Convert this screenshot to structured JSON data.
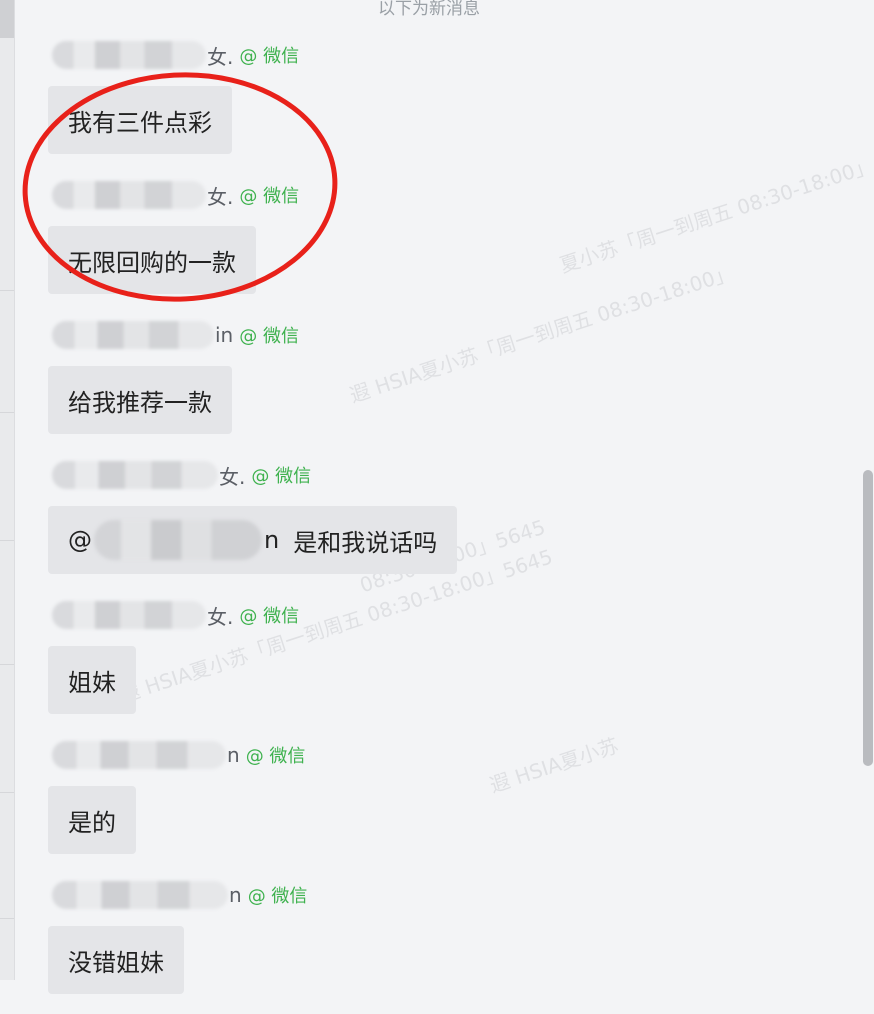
{
  "top_hint": "以下为新消息",
  "messages": [
    {
      "name_suffix": "女.",
      "platform": "@ 微信",
      "text": "我有三件点彩"
    },
    {
      "name_suffix": "女.",
      "platform": "@ 微信",
      "text": "无限回购的一款"
    },
    {
      "name_suffix": "in",
      "platform": "@ 微信",
      "text": "给我推荐一款"
    },
    {
      "name_suffix": "女.",
      "platform": "@ 微信",
      "mention_prefix": "@",
      "mention_suffix": "n",
      "text": "是和我说话吗"
    },
    {
      "name_suffix": "女.",
      "platform": "@ 微信",
      "text": "姐妹"
    },
    {
      "name_suffix": "n",
      "platform": "@ 微信",
      "text": "是的"
    },
    {
      "name_suffix": "n",
      "platform": "@ 微信",
      "text": "没错姐妹"
    }
  ],
  "watermarks": [
    "遐 HSIA夏小苏「周一到周五 08:30-18:00」",
    "遐 HSIA夏小苏「周一到周五 08:30-18:00」5645",
    "遐 HSIA夏小苏",
    "夏小苏「周一到周五 08:30-18:00」",
    "08:30-18:00」5645"
  ],
  "annotation": {
    "shape": "ellipse",
    "color": "#e8211a"
  }
}
